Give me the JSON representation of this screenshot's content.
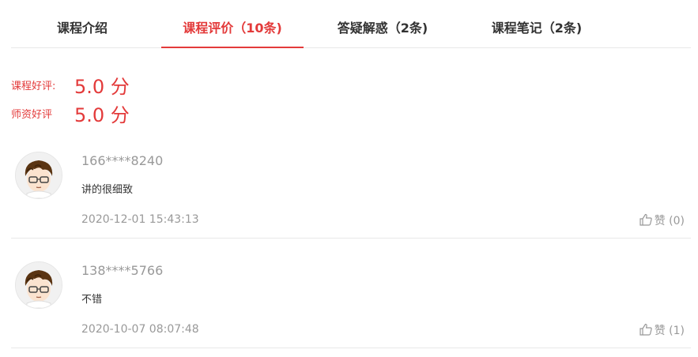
{
  "tabs": [
    {
      "label": "课程介绍",
      "active": false
    },
    {
      "label": "课程评价（10条)",
      "active": true
    },
    {
      "label": "答疑解惑（2条)",
      "active": false
    },
    {
      "label": "课程笔记（2条)",
      "active": false
    }
  ],
  "ratings": [
    {
      "label": "课程好评:",
      "value": "5.0 分"
    },
    {
      "label": "师资好评",
      "value": "5.0 分"
    }
  ],
  "comments": [
    {
      "user": "166****8240",
      "text": "讲的很细致",
      "time": "2020-12-01 15:43:13",
      "like_label": "赞",
      "like_count": "(0)"
    },
    {
      "user": "138****5766",
      "text": "不错",
      "time": "2020-10-07 08:07:48",
      "like_label": "赞",
      "like_count": "(1)"
    }
  ],
  "colors": {
    "accent": "#e33a3a",
    "muted": "#999999",
    "divider": "#e8e8e8"
  },
  "icons": {
    "avatar": "cartoon-user-avatar",
    "like": "thumbs-up-icon"
  }
}
